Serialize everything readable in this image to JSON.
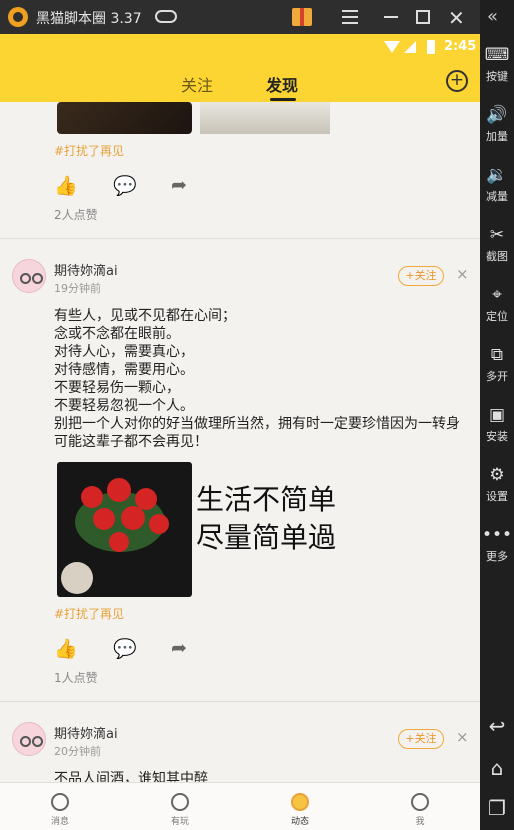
{
  "window": {
    "title": "黑猫脚本圈 3.37",
    "icons": [
      "app-logo-icon",
      "gamepad-icon",
      "gift-icon",
      "menu-icon",
      "minimize-icon",
      "maximize-icon",
      "close-icon"
    ]
  },
  "toolbar": {
    "items": [
      {
        "label": "按键",
        "icon": "keyboard-icon"
      },
      {
        "label": "加量",
        "icon": "volume-up-icon"
      },
      {
        "label": "减量",
        "icon": "volume-down-icon"
      },
      {
        "label": "截图",
        "icon": "scissors-icon"
      },
      {
        "label": "定位",
        "icon": "location-icon"
      },
      {
        "label": "多开",
        "icon": "multi-instance-icon"
      },
      {
        "label": "安装",
        "icon": "apk-icon"
      },
      {
        "label": "设置",
        "icon": "gear-icon"
      },
      {
        "label": "更多",
        "icon": "more-icon"
      }
    ],
    "nav_icons": [
      "back-icon",
      "home-icon",
      "recents-icon"
    ]
  },
  "status_bar": {
    "time": "2:45"
  },
  "header": {
    "tabs": [
      {
        "label": "关注",
        "active": false
      },
      {
        "label": "发现",
        "active": true
      }
    ],
    "add_icon": "plus-circle-icon"
  },
  "posts": [
    {
      "tag": "#打扰了再见",
      "likes_text": "2人点赞",
      "liked": true
    },
    {
      "username": "期待妳滴ai",
      "time": "19分钟前",
      "follow_label": "+关注",
      "dismiss": "×",
      "lines": [
        "有些人，见或不见都在心间；",
        "念或不念都在眼前。",
        "对待人心，需要真心，",
        "对待感情，需要用心。",
        "不要轻易伤一颗心，",
        "不要轻易忽视一个人。",
        "别把一个人对你的好当做理所当然，拥有时一定要珍惜因为一转身可能这辈子都不会再见！"
      ],
      "image_text": [
        "生活不简单",
        "尽量简单過"
      ],
      "tag": "#打扰了再见",
      "likes_text": "1人点赞",
      "liked": false
    },
    {
      "username": "期待妳滴ai",
      "time": "20分钟前",
      "follow_label": "+关注",
      "dismiss": "×",
      "lines": [
        "不品人间酒，谁知其中醉"
      ]
    }
  ],
  "bottom_nav": [
    {
      "label": "消息",
      "icon": "message-icon",
      "active": false
    },
    {
      "label": "有玩",
      "icon": "compass-icon",
      "active": false
    },
    {
      "label": "动态",
      "icon": "planet-icon",
      "active": true
    },
    {
      "label": "我",
      "icon": "smiley-icon",
      "active": false
    }
  ],
  "colors": {
    "brand_yellow": "#fdd533",
    "accent_orange": "#e8a23a"
  }
}
